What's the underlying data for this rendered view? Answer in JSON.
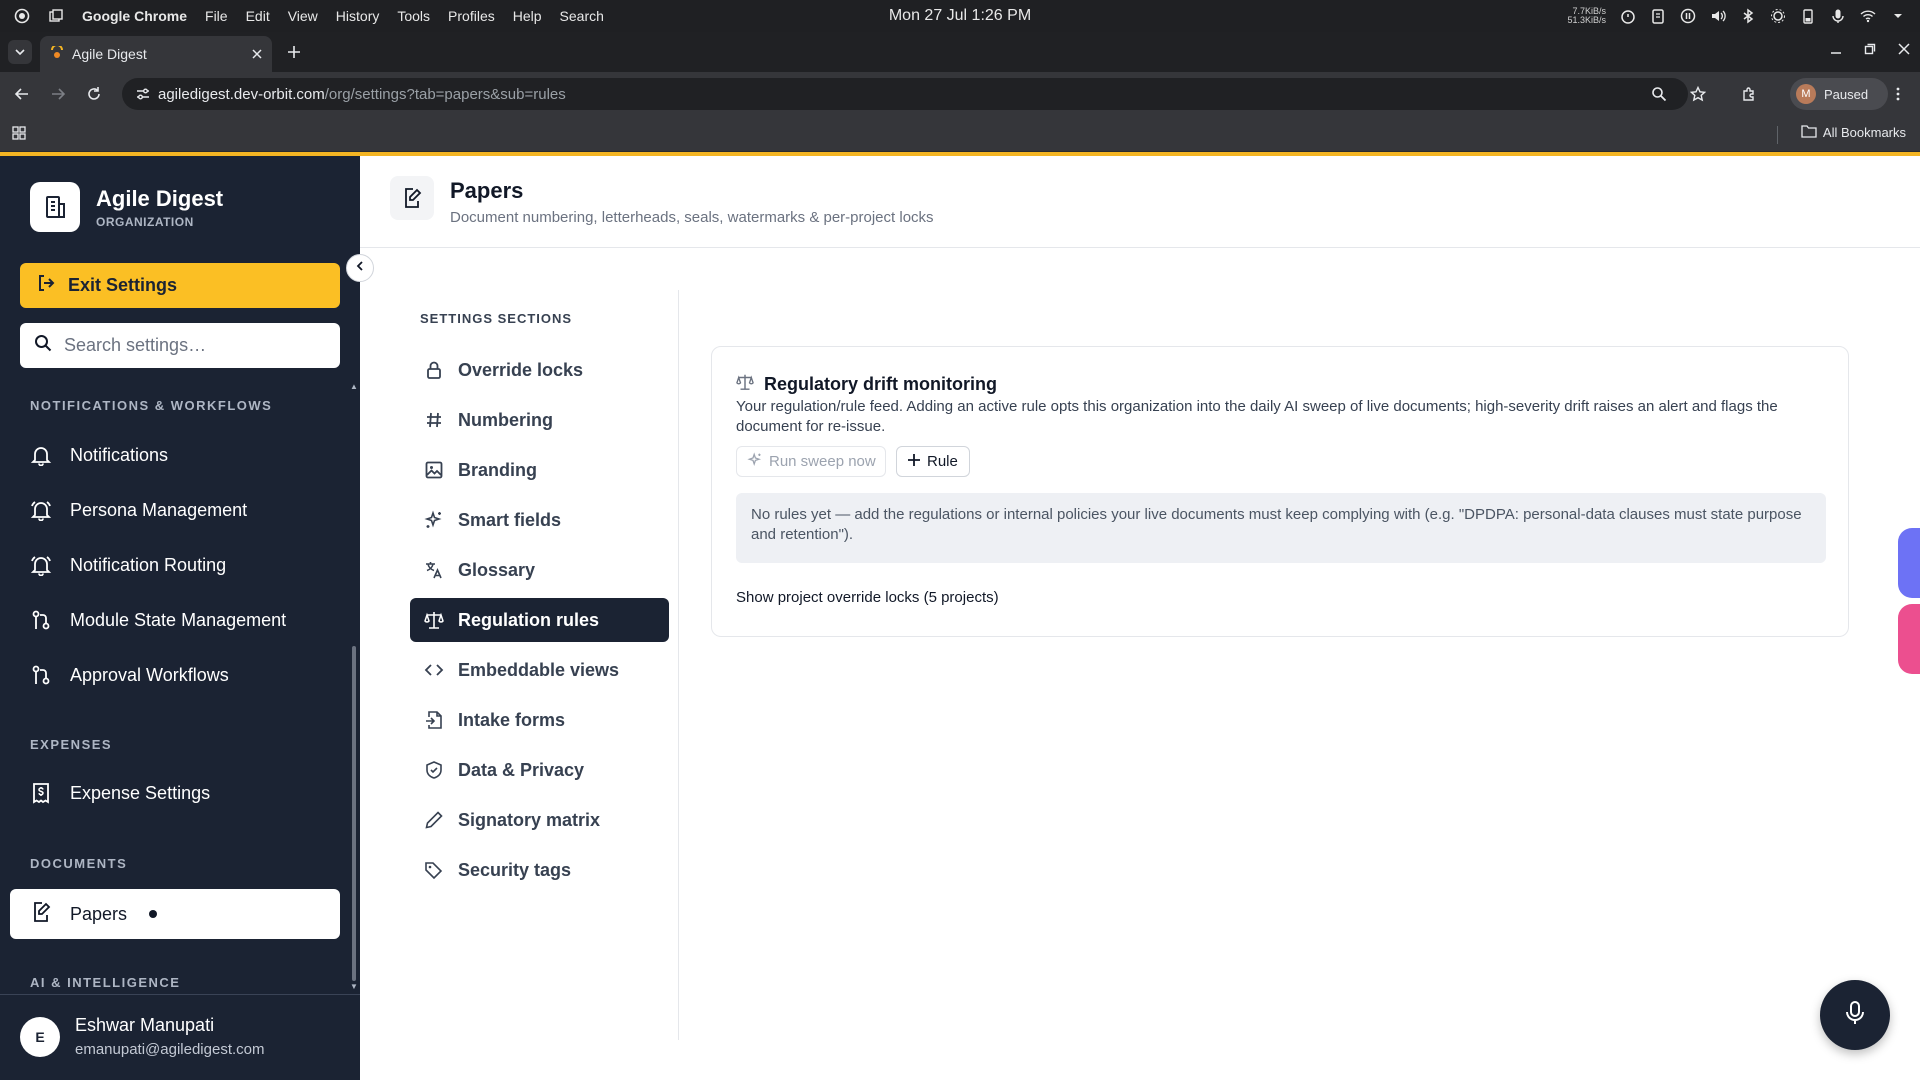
{
  "os": {
    "app_name": "Google Chrome",
    "menu": [
      "File",
      "Edit",
      "View",
      "History",
      "Tools",
      "Profiles",
      "Help",
      "Search"
    ],
    "clock": "Mon 27 Jul  1:26 PM",
    "net_up": "7.7KiB/s",
    "net_down": "51.3KiB/s"
  },
  "browser": {
    "tab_title": "Agile Digest",
    "url_host": "agiledigest.dev-orbit.com",
    "url_path": "/org/settings?tab=papers&sub=rules",
    "profile_initial": "M",
    "profile_status": "Paused",
    "all_bookmarks": "All Bookmarks"
  },
  "sidebar": {
    "org_name": "Agile Digest",
    "org_sub": "ORGANIZATION",
    "exit_label": "Exit Settings",
    "search_placeholder": "Search settings…",
    "sections": [
      {
        "label": "NOTIFICATIONS & WORKFLOWS"
      },
      {
        "label": "EXPENSES"
      },
      {
        "label": "DOCUMENTS"
      },
      {
        "label": "AI & INTELLIGENCE"
      }
    ],
    "items": [
      {
        "label": "Notifications",
        "icon": "bell-icon"
      },
      {
        "label": "Persona Management",
        "icon": "bell-ring-icon"
      },
      {
        "label": "Notification Routing",
        "icon": "bell-ring-icon"
      },
      {
        "label": "Module State Management",
        "icon": "git-pull-request-icon"
      },
      {
        "label": "Approval Workflows",
        "icon": "git-pull-request-icon"
      },
      {
        "label": "Expense Settings",
        "icon": "receipt-icon"
      },
      {
        "label": "Papers",
        "icon": "file-edit-icon"
      }
    ],
    "user": {
      "initial": "E",
      "name": "Eshwar Manupati",
      "email": "emanupati@agiledigest.com"
    }
  },
  "header": {
    "title": "Papers",
    "subtitle": "Document numbering, letterheads, seals, watermarks & per-project locks"
  },
  "settings": {
    "label": "SETTINGS SECTIONS",
    "items": [
      {
        "label": "Override locks",
        "icon": "lock-icon"
      },
      {
        "label": "Numbering",
        "icon": "hash-icon"
      },
      {
        "label": "Branding",
        "icon": "image-icon"
      },
      {
        "label": "Smart fields",
        "icon": "sparkles-icon"
      },
      {
        "label": "Glossary",
        "icon": "languages-icon"
      },
      {
        "label": "Regulation rules",
        "icon": "scale-icon"
      },
      {
        "label": "Embeddable views",
        "icon": "code-icon"
      },
      {
        "label": "Intake forms",
        "icon": "file-input-icon"
      },
      {
        "label": "Data & Privacy",
        "icon": "shield-check-icon"
      },
      {
        "label": "Signatory matrix",
        "icon": "pen-icon"
      },
      {
        "label": "Security tags",
        "icon": "tag-icon"
      }
    ],
    "active_index": 5
  },
  "card": {
    "title": "Regulatory drift monitoring",
    "description": "Your regulation/rule feed. Adding an active rule opts this organization into the daily AI sweep of live documents; high-severity drift raises an alert and flags the document for re-issue.",
    "run_label": "Run sweep now",
    "rule_label": "Rule",
    "empty_text": "No rules yet — add the regulations or internal policies your live documents must keep complying with (e.g. \"DPDPA: personal-data clauses must state purpose and retention\").",
    "show_locks": "Show project override locks (5 projects)"
  },
  "colors": {
    "sidebar_bg": "#1b2333",
    "accent": "#fbbf24",
    "active_section_bg": "#1b2333"
  }
}
